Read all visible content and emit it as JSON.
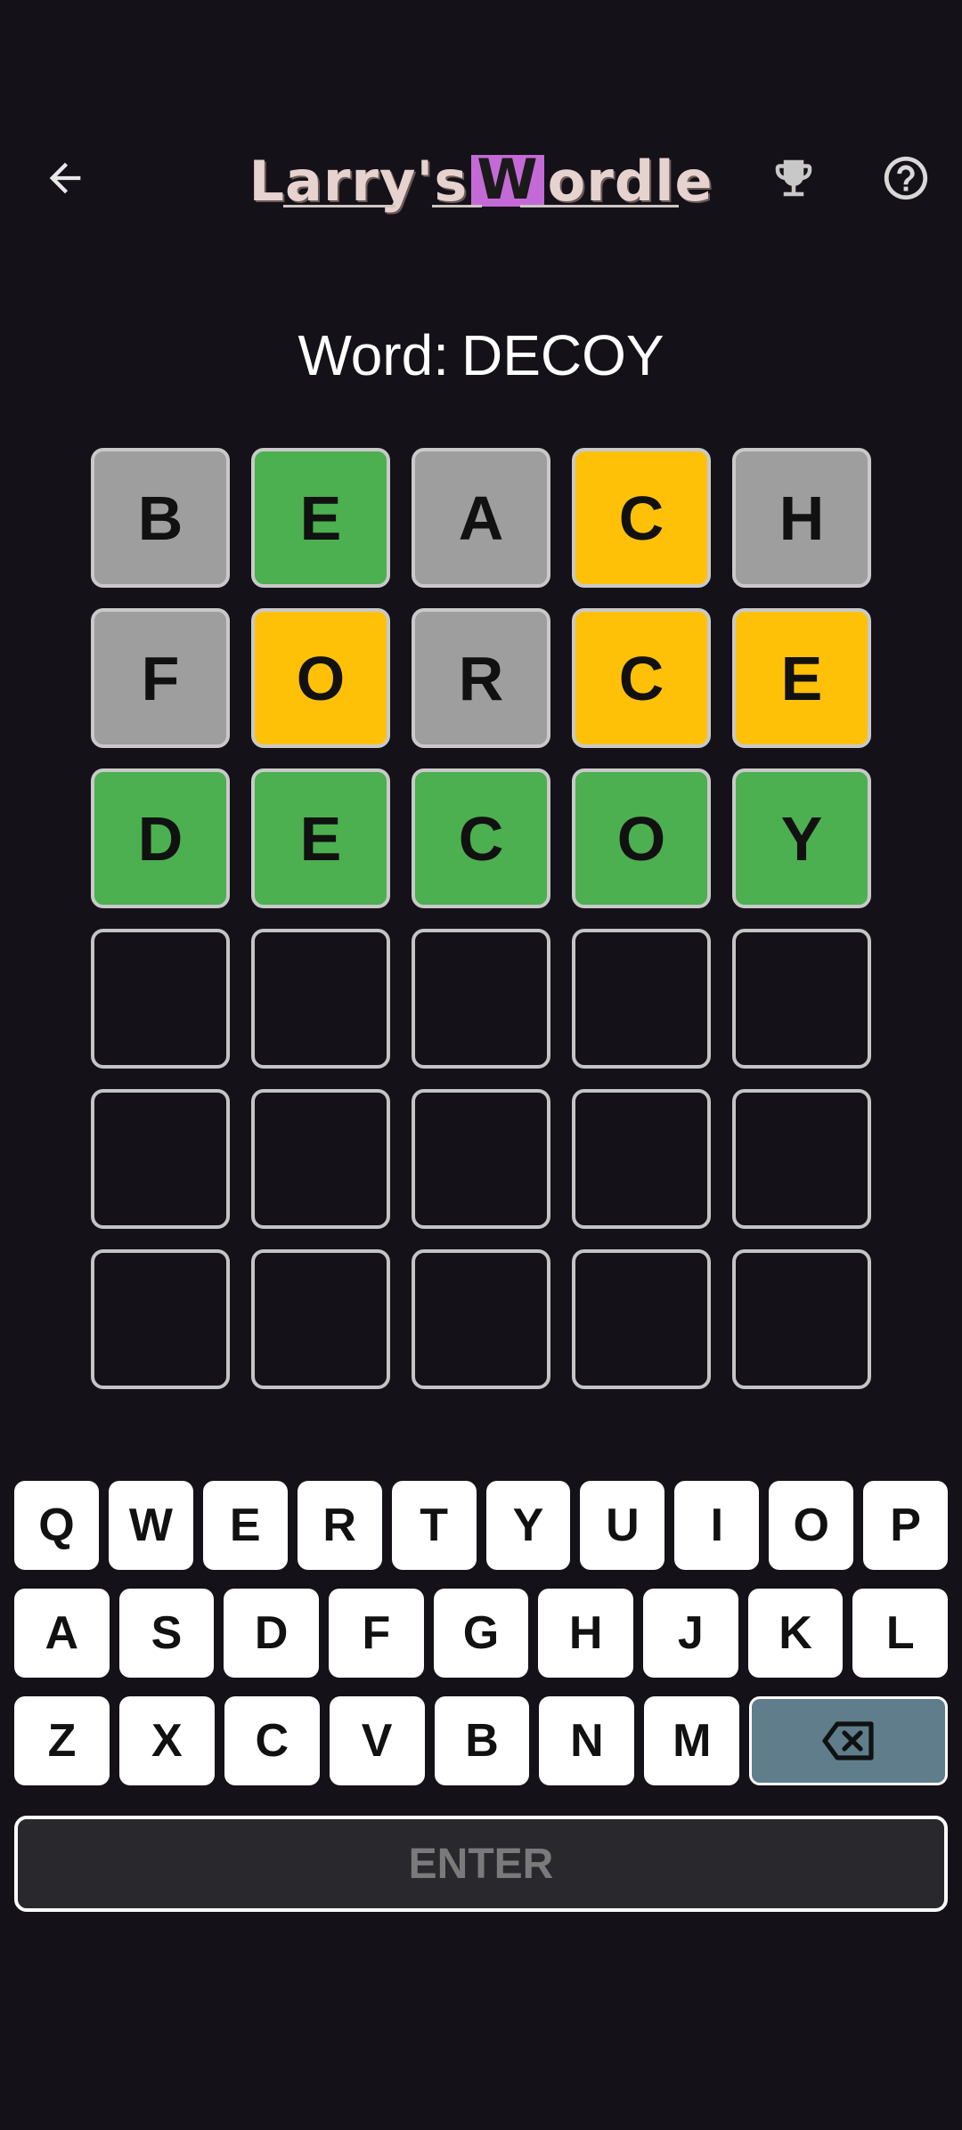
{
  "header": {
    "logo": {
      "prefix": "Larry's ",
      "highlight": "W",
      "suffix": "ordle"
    },
    "back_icon": "arrow-left-icon",
    "trophy_icon": "trophy-icon",
    "help_icon": "help-circle-icon"
  },
  "word_label": {
    "prefix": "Word:",
    "word": "DECOY"
  },
  "colors": {
    "correct": "#4caf50",
    "present": "#ffc107",
    "absent": "#9e9e9e",
    "background": "#141218",
    "backspace": "#607d8b"
  },
  "board": [
    [
      {
        "l": "B",
        "s": "absent"
      },
      {
        "l": "E",
        "s": "correct"
      },
      {
        "l": "A",
        "s": "absent"
      },
      {
        "l": "C",
        "s": "present"
      },
      {
        "l": "H",
        "s": "absent"
      }
    ],
    [
      {
        "l": "F",
        "s": "absent"
      },
      {
        "l": "O",
        "s": "present"
      },
      {
        "l": "R",
        "s": "absent"
      },
      {
        "l": "C",
        "s": "present"
      },
      {
        "l": "E",
        "s": "present"
      }
    ],
    [
      {
        "l": "D",
        "s": "correct"
      },
      {
        "l": "E",
        "s": "correct"
      },
      {
        "l": "C",
        "s": "correct"
      },
      {
        "l": "O",
        "s": "correct"
      },
      {
        "l": "Y",
        "s": "correct"
      }
    ],
    [
      {
        "l": "",
        "s": "empty"
      },
      {
        "l": "",
        "s": "empty"
      },
      {
        "l": "",
        "s": "empty"
      },
      {
        "l": "",
        "s": "empty"
      },
      {
        "l": "",
        "s": "empty"
      }
    ],
    [
      {
        "l": "",
        "s": "empty"
      },
      {
        "l": "",
        "s": "empty"
      },
      {
        "l": "",
        "s": "empty"
      },
      {
        "l": "",
        "s": "empty"
      },
      {
        "l": "",
        "s": "empty"
      }
    ],
    [
      {
        "l": "",
        "s": "empty"
      },
      {
        "l": "",
        "s": "empty"
      },
      {
        "l": "",
        "s": "empty"
      },
      {
        "l": "",
        "s": "empty"
      },
      {
        "l": "",
        "s": "empty"
      }
    ]
  ],
  "keyboard": {
    "row1": [
      "Q",
      "W",
      "E",
      "R",
      "T",
      "Y",
      "U",
      "I",
      "O",
      "P"
    ],
    "row2": [
      "A",
      "S",
      "D",
      "F",
      "G",
      "H",
      "J",
      "K",
      "L"
    ],
    "row3": [
      "Z",
      "X",
      "C",
      "V",
      "B",
      "N",
      "M"
    ],
    "backspace_icon": "backspace-icon",
    "enter_label": "ENTER"
  }
}
